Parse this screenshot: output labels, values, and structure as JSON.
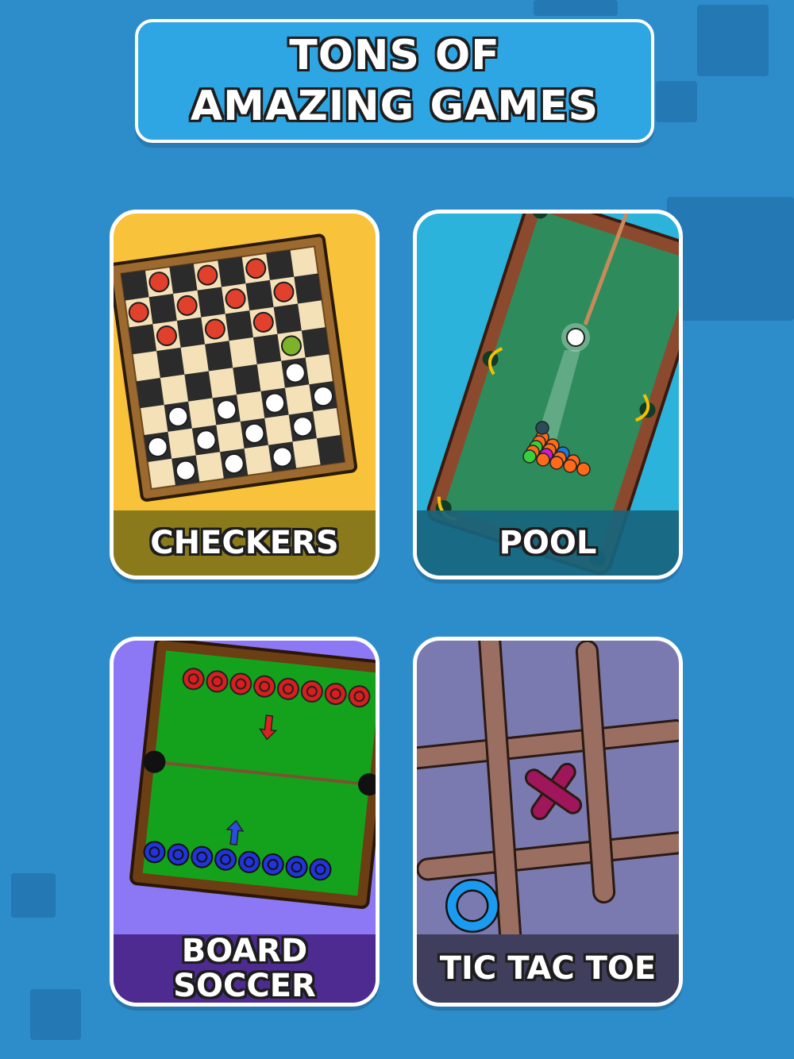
{
  "banner": {
    "line1": "TONS OF",
    "line2": "AMAZING GAMES"
  },
  "games": [
    {
      "label": "CHECKERS",
      "bg": "#f8c23a",
      "band": "#8a7a1c"
    },
    {
      "label": "POOL",
      "bg": "#2bb3dc",
      "band": "#17708d"
    },
    {
      "label_line1": "BOARD",
      "label_line2": "SOCCER",
      "bg": "#8c78f5",
      "band": "#4e2b91"
    },
    {
      "label": "TIC TAC TOE",
      "bg": "#7b7ab0",
      "band": "#3f3f5d"
    }
  ],
  "colors": {
    "background": "#2d8cca",
    "banner": "#2fa6e4"
  }
}
